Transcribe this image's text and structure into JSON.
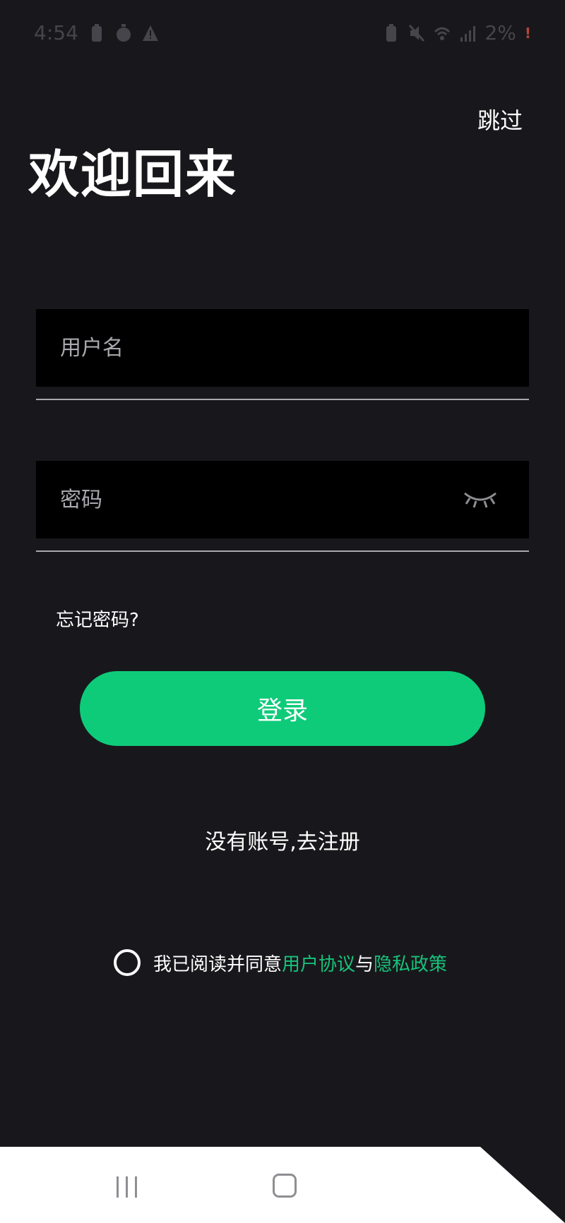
{
  "status_bar": {
    "time": "4:54",
    "battery": "2%",
    "left_icons": [
      "battery-saver-icon",
      "stopwatch-icon",
      "warning-icon"
    ],
    "right_icons": [
      "battery-icon",
      "mute-icon",
      "wifi-icon",
      "signal-icon"
    ]
  },
  "header": {
    "skip_label": "跳过",
    "title": "欢迎回来"
  },
  "form": {
    "username_placeholder": "用户名",
    "password_placeholder": "密码",
    "forgot_password_label": "忘记密码?",
    "login_label": "登录",
    "register_label": "没有账号,去注册"
  },
  "agreement": {
    "prefix": "我已阅读并同意",
    "user_agreement_link": "用户协议",
    "conjunction": "与",
    "privacy_policy_link": "隐私政策"
  },
  "colors": {
    "background": "#18181c",
    "accent": "#0ecb7a",
    "link": "#17c27a",
    "field_background": "#000000"
  }
}
